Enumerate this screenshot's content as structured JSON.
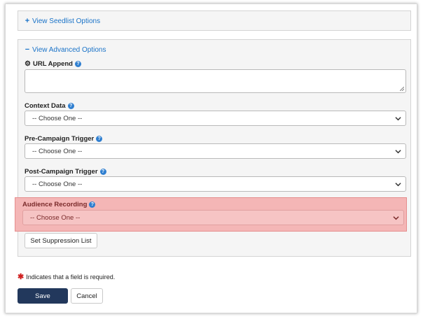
{
  "seedlist": {
    "label": "View Seedlist Options",
    "icon": "plus-icon"
  },
  "advanced": {
    "label": "View Advanced Options",
    "icon": "minus-icon",
    "url_append": {
      "label": "URL Append",
      "icon": "gear-icon",
      "value": ""
    },
    "context_data": {
      "label": "Context Data",
      "selected": "-- Choose One --"
    },
    "pre_campaign_trigger": {
      "label": "Pre-Campaign Trigger",
      "selected": "-- Choose One --"
    },
    "post_campaign_trigger": {
      "label": "Post-Campaign Trigger",
      "selected": "-- Choose One --"
    },
    "audience_recording": {
      "label": "Audience Recording",
      "selected": "-- Choose One --"
    },
    "suppression_button": "Set Suppression List"
  },
  "required_note": "Indicates that a field is required.",
  "actions": {
    "save": "Save",
    "cancel": "Cancel"
  },
  "colors": {
    "link": "#1a73c8",
    "primary": "#22385c",
    "highlight": "#f4b6b6",
    "required": "#d02020"
  }
}
